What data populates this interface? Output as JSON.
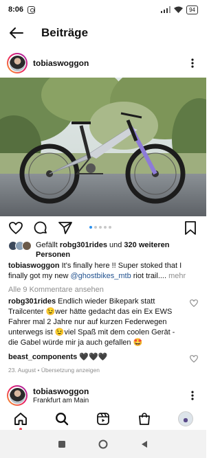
{
  "status_bar": {
    "time": "8:06",
    "battery": "94"
  },
  "header": {
    "title": "Beiträge"
  },
  "post": {
    "username": "tobiaswoggon",
    "image_alt": "post-photo",
    "likes": {
      "prefix": "Gefällt ",
      "first_liker": "robg301rides",
      "middle": " und ",
      "others": "320 weiteren Personen"
    },
    "caption": {
      "username": "tobiaswoggon",
      "text_before": " It's finally here !! Super stoked that I finally got my new ",
      "mention": "@ghostbikes_mtb",
      "text_after": " riot trail.... ",
      "more": "mehr"
    },
    "view_comments": "Alle 9 Kommentare ansehen",
    "comments": [
      {
        "username": "robg301rides",
        "text": " Endlich wieder Bikepark statt Trailcenter 😉wer hätte gedacht das ein Ex EWS Fahrer mal 2 Jahre nur auf kurzen Federwegen unterwegs ist 😉viel Spaß mit dem coolen Gerät - die Gabel würde mir ja auch gefallen 🤩"
      },
      {
        "username": "beast_components",
        "text": " 🖤🖤🖤"
      }
    ],
    "date": "23. August",
    "separator": " • ",
    "translate": "Übersetzung anzeigen"
  },
  "next_post": {
    "username": "tobiaswoggon",
    "location": "Frankfurt am Main"
  },
  "colors": {
    "accent": "#2b90ef",
    "link": "#22528f",
    "muted": "#8e8e8e",
    "notification": "#ed4956"
  }
}
